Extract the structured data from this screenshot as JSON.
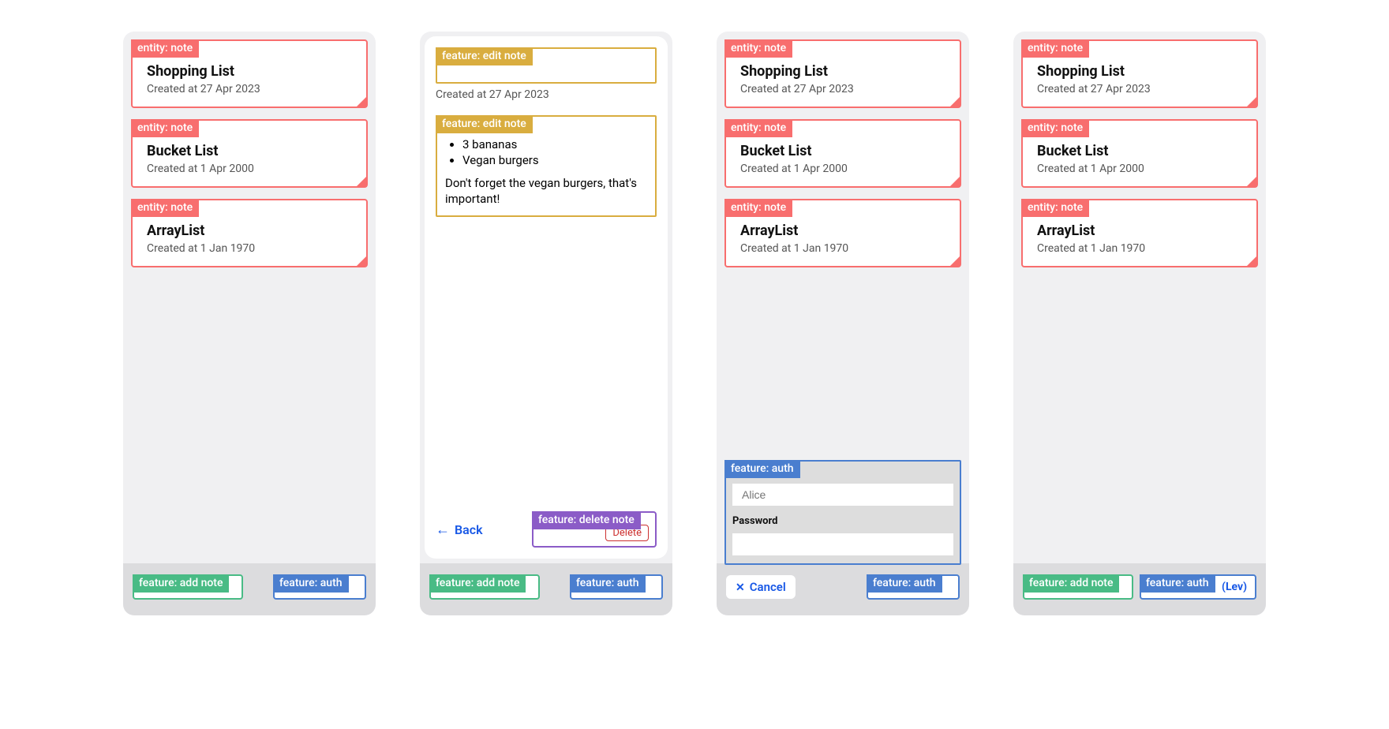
{
  "labels": {
    "entity_note": "entity: note",
    "feature_add_note": "feature: add note",
    "feature_auth": "feature: auth",
    "feature_edit_note": "feature: edit note",
    "feature_delete_note": "feature: delete note"
  },
  "notes": [
    {
      "title": "Shopping List",
      "subtitle": "Created at 27 Apr 2023"
    },
    {
      "title": "Bucket List",
      "subtitle": "Created at 1 Apr 2000"
    },
    {
      "title": "ArrayList",
      "subtitle": "Created at 1 Jan 1970"
    }
  ],
  "detail": {
    "created": "Created at 27 Apr 2023",
    "bullets": [
      "3 bananas",
      "Vegan burgers"
    ],
    "body": "Don't forget the vegan burgers, that's important!",
    "back": "Back",
    "delete": "Delete"
  },
  "auth": {
    "username_placeholder": "Alice",
    "password_label": "Password",
    "cancel": "Cancel",
    "signed_in_suffix": "(Lev)"
  }
}
